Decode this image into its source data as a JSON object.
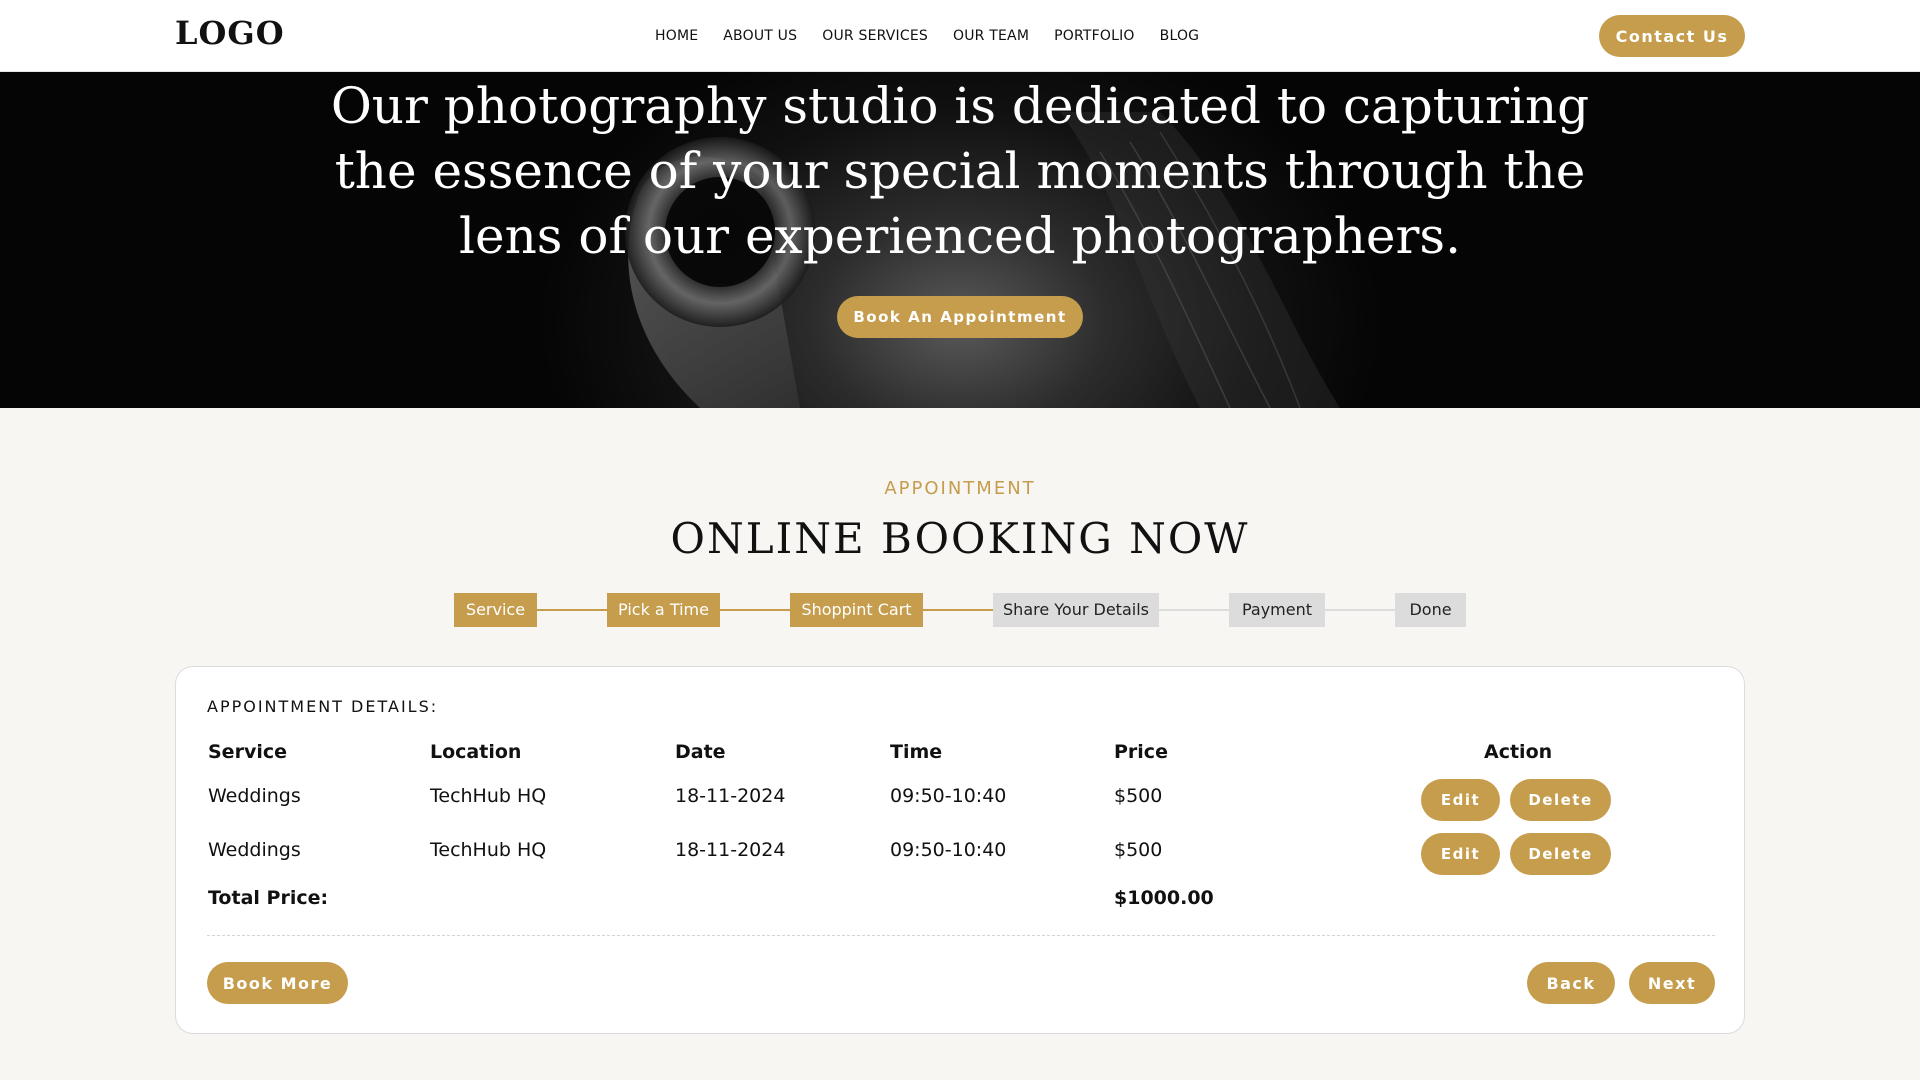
{
  "header": {
    "logo": "LOGO",
    "nav": [
      "HOME",
      "ABOUT US",
      "OUR SERVICES",
      "OUR TEAM",
      "PORTFOLIO",
      "BLOG"
    ],
    "contact_label": "Contact Us"
  },
  "hero": {
    "lines": [
      "Our photography studio is dedicated to capturing",
      "the essence of your special moments through the",
      "lens of our experienced photographers."
    ],
    "cta_label": "Book An Appointment"
  },
  "booking": {
    "kicker": "APPOINTMENT",
    "title": "ONLINE BOOKING NOW",
    "steps": [
      {
        "label": "Service",
        "state": "done"
      },
      {
        "label": "Pick a Time",
        "state": "done"
      },
      {
        "label": "Shoppint Cart",
        "state": "done"
      },
      {
        "label": "Share Your Details",
        "state": "todo"
      },
      {
        "label": "Payment",
        "state": "todo"
      },
      {
        "label": "Done",
        "state": "todo"
      }
    ],
    "details_title": "APPOINTMENT DETAILS:",
    "columns": [
      "Service",
      "Location",
      "Date",
      "Time",
      "Price",
      "Action"
    ],
    "rows": [
      {
        "service": "Weddings",
        "location": "TechHub HQ",
        "date": "18-11-2024",
        "time": "09:50-10:40",
        "price": "$500"
      },
      {
        "service": "Weddings",
        "location": "TechHub HQ",
        "date": "18-11-2024",
        "time": "09:50-10:40",
        "price": "$500"
      }
    ],
    "edit_label": "Edit",
    "delete_label": "Delete",
    "total_label": "Total Price:",
    "total_value": "$1000.00",
    "book_more_label": "Book More",
    "back_label": "Back",
    "next_label": "Next"
  },
  "colors": {
    "accent": "#c59d4c",
    "step_inactive": "#dcdcdc"
  }
}
